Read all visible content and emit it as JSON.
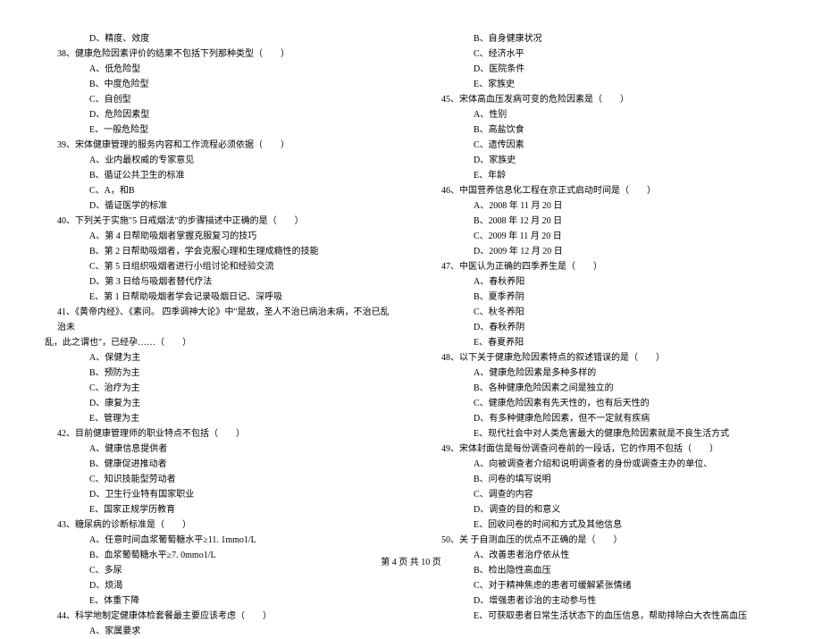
{
  "col1": {
    "line_d_prev": "D、精度、效度",
    "q38": {
      "stem": "38、健康危险因素评价的结果不包括下列那种类型（　　）",
      "opts": [
        "A、低危险型",
        "B、中度危险型",
        "C、自创型",
        "D、危险因素型",
        "E、一般危险型"
      ]
    },
    "q39": {
      "stem": "39、宋体健康管理的服务内容和工作流程必须依据（　　）",
      "opts": [
        "A、业内最权威的专家意见",
        "B、循证公共卫生的标准",
        "C、A，和B",
        "D、循证医学的标准"
      ]
    },
    "q40": {
      "stem": "40、下列关于实施\"5 日戒烟法\"的步骤描述中正确的是（　　）",
      "opts": [
        "A、第 4 日帮助吸烟者掌握克服复习的技巧",
        "B、第 2 日帮助吸烟者，学会克服心理和生理成瘾性的技能",
        "C、第 5 日组织吸烟者进行小组讨论和经验交流",
        "D、第 3 日给与吸烟者替代疗法",
        "E、第 1 日帮助吸烟者学会记录吸烟日记、深呼吸"
      ]
    },
    "q41": {
      "stem_l1": "41、《黄帝内经》、《素问。 四季调神大论》中\"是故，圣人不治已病治未病，不治已乱治未",
      "stem_l2": "乱，此之谓也\"，已经孕……（　　）",
      "opts": [
        "A、保健为主",
        "B、预防为主",
        "C、治疗为主",
        "D、康复为主",
        "E、管理为主"
      ]
    },
    "q42": {
      "stem": "42、目前健康管理师的职业特点不包括（　　）",
      "opts": [
        "A、健康信息提供者",
        "B、健康促进推动者",
        "C、知识技能型劳动者",
        "D、卫生行业特有国家职业",
        "E、国家正规学历教育"
      ]
    },
    "q43": {
      "stem": "43、糖尿病的诊断标准是（　　）",
      "opts": [
        "A、任意时间血浆葡萄糖水平≥11. 1mmo1/L",
        "B、血浆葡萄糖水平≥7. 0mmo1/L",
        "C、多尿",
        "D、烦渴",
        "E、体重下降"
      ]
    },
    "q44": {
      "stem": "44、科学地制定健康体检套餐最主要应该考虑（　　）",
      "opts": [
        "A、家属要求"
      ]
    }
  },
  "col2": {
    "q44_cont": [
      "B、自身健康状况",
      "C、经济水平",
      "D、医院条件",
      "E、家族史"
    ],
    "q45": {
      "stem": "45、宋体高血压发病可变的危险因素是（　　）",
      "opts": [
        "A、性别",
        "B、高盐饮食",
        "C、遗传因素",
        "D、家族史",
        "E、年龄"
      ]
    },
    "q46": {
      "stem": "46、中国营养信息化工程在京正式启动时间是（　　）",
      "opts": [
        "A、2008 年 11 月 20 日",
        "B、2008 年 12 月 20 日",
        "C、2009 年 11 月 20 日",
        "D、2009 年 12 月 20 日"
      ]
    },
    "q47": {
      "stem": "47、中医认为正确的四季养生是（　　）",
      "opts": [
        "A、春秋养阳",
        "B、夏季养阴",
        "C、秋冬养阳",
        "D、春秋养阴",
        "E、春夏养阳"
      ]
    },
    "q48": {
      "stem": "48、以下关于健康危险因素特点的叙述错误的是（　　）",
      "opts": [
        "A、健康危险因素是多种多样的",
        "B、各种健康危险因素之间是独立的",
        "C、健康危险因素有先天性的，也有后天性的",
        "D、有多种健康危险因素，但不一定就有疾病",
        "E、现代社会中对人类危害最大的健康危险因素就是不良生活方式"
      ]
    },
    "q49": {
      "stem": "49、宋体封面信是每份调查问卷前的一段话，它的作用不包括（　　）",
      "opts": [
        "A、向被调查者介绍和说明调查者的身份或调查主办的单位、",
        "B、问卷的填写说明",
        "C、调查的内容",
        "D、调查的目的和意义",
        "E、回收问卷的时间和方式及其他信息"
      ]
    },
    "q50": {
      "stem": "50、关 于自测血压的优点不正确的是（　　）",
      "opts": [
        "A、改善患者治疗依从性",
        "B、检出隐性高血压",
        "C、对于精神焦虑的患者可缓解紧张情绪",
        "D、增强患者诊治的主动参与性",
        "E、可获取患者日常生活状态下的血压信息，帮助排除白大衣性高血压"
      ]
    }
  },
  "footer": "第 4 页 共 10 页"
}
